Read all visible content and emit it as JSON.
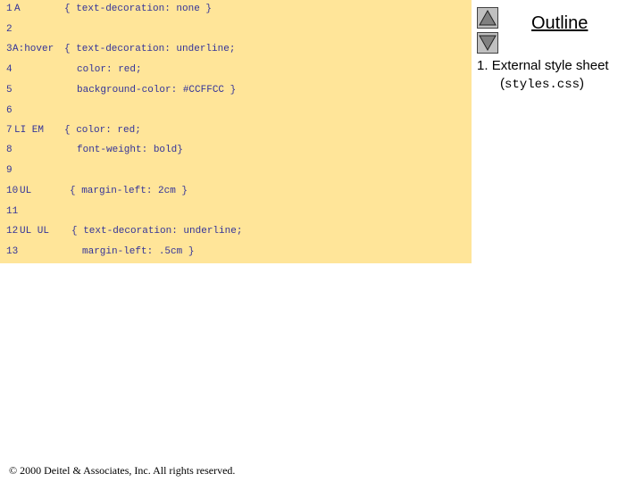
{
  "code_lines": [
    {
      "n": "1",
      "selector": "A",
      "rest": "{ text-decoration: none }"
    },
    {
      "n": "2",
      "selector": "",
      "rest": ""
    },
    {
      "n": "3",
      "selector": "A:hover",
      "rest": "{ text-decoration: underline;"
    },
    {
      "n": "4",
      "selector": "",
      "rest": "color: red;"
    },
    {
      "n": "5",
      "selector": "",
      "rest": "background-color: #CCFFCC }"
    },
    {
      "n": "6",
      "selector": "",
      "rest": ""
    },
    {
      "n": "7",
      "selector": "LI EM",
      "rest": "{ color: red;"
    },
    {
      "n": "8",
      "selector": "",
      "rest": "font-weight: bold}"
    },
    {
      "n": "9",
      "selector": "",
      "rest": ""
    },
    {
      "n": "10",
      "selector": "UL",
      "rest": "{ margin-left: 2cm }"
    },
    {
      "n": "11",
      "selector": "",
      "rest": ""
    },
    {
      "n": "12",
      "selector": "UL UL",
      "rest": "{ text-decoration: underline;"
    },
    {
      "n": "13",
      "selector": "",
      "rest": "margin-left: .5cm }"
    }
  ],
  "outline": {
    "title": "Outline",
    "item_number": "1.",
    "item_text": "External style sheet",
    "item_open": "(",
    "item_code": "styles.css",
    "item_close": ")"
  },
  "footer": "© 2000 Deitel & Associates, Inc.  All rights reserved.",
  "icons": {
    "up": "triangle-up-icon",
    "down": "triangle-down-icon"
  },
  "colors": {
    "panel": "#ffe599",
    "code_text": "#333399",
    "code_value": "#1a7fd4"
  }
}
